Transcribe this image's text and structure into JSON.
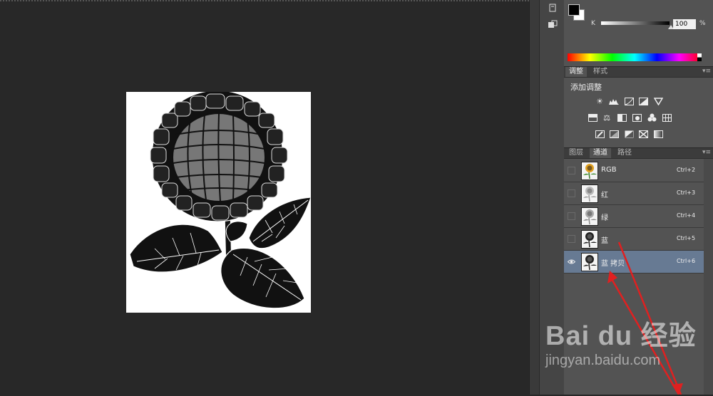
{
  "color_panel": {
    "channel_label": "K",
    "value": "100",
    "unit": "%",
    "foreground": "#000000",
    "background": "#ffffff"
  },
  "adjustments_panel": {
    "tabs": [
      {
        "label": "调整",
        "active": true
      },
      {
        "label": "样式",
        "active": false
      }
    ],
    "title": "添加调整",
    "icons": [
      "brightness-icon",
      "levels-icon",
      "curves-icon",
      "exposure-icon",
      "vibrance-icon",
      "hue-saturation-icon",
      "color-balance-icon",
      "black-white-icon",
      "photo-filter-icon",
      "channel-mixer-icon",
      "color-lookup-icon",
      "invert-icon",
      "posterize-icon",
      "threshold-icon",
      "selective-color-icon",
      "gradient-map-icon"
    ]
  },
  "channels_panel": {
    "tabs": [
      {
        "label": "图层",
        "active": false
      },
      {
        "label": "通道",
        "active": true
      },
      {
        "label": "路径",
        "active": false
      }
    ],
    "channels": [
      {
        "name": "RGB",
        "shortcut": "Ctrl+2",
        "visible": false,
        "selected": false,
        "thumb": "color"
      },
      {
        "name": "红",
        "shortcut": "Ctrl+3",
        "visible": false,
        "selected": false,
        "thumb": "light"
      },
      {
        "name": "绿",
        "shortcut": "Ctrl+4",
        "visible": false,
        "selected": false,
        "thumb": "light"
      },
      {
        "name": "蓝",
        "shortcut": "Ctrl+5",
        "visible": false,
        "selected": false,
        "thumb": "dark"
      },
      {
        "name": "蓝 拷贝",
        "shortcut": "Ctrl+6",
        "visible": true,
        "selected": true,
        "thumb": "dark"
      }
    ]
  },
  "watermark": {
    "logo": "Bai du 经验",
    "url": "jingyan.baidu.com"
  },
  "colors": {
    "selected_row": "#677a93",
    "annotation_arrow": "#e02020"
  }
}
